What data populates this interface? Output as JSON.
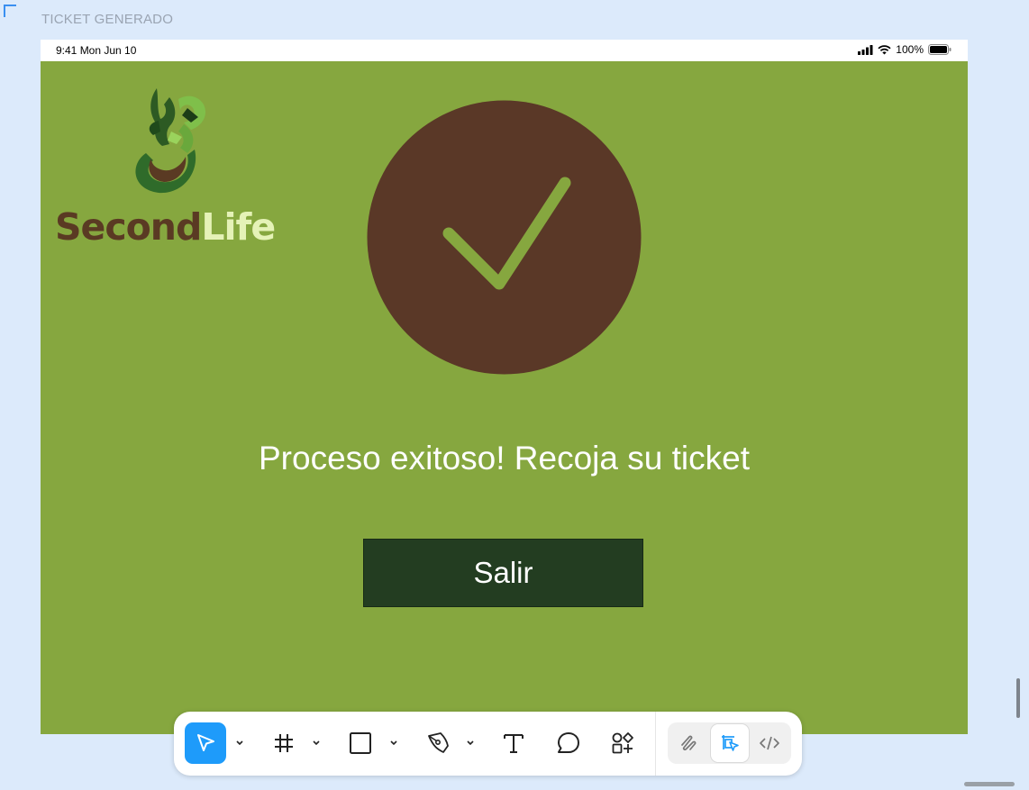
{
  "frame": {
    "label": "TICKET GENERADO"
  },
  "status_bar": {
    "time": "9:41  Mon Jun 10",
    "battery": "100%"
  },
  "logo": {
    "part1": "Second",
    "part2": "Life"
  },
  "main": {
    "message": "Proceso exitoso! Recoja su ticket",
    "exit_label": "Salir"
  },
  "colors": {
    "background": "#86a73f",
    "circle": "#5a3827",
    "button": "#233d21",
    "accent": "#1e9bfa"
  },
  "toolbar": {
    "tools": [
      {
        "icon": "move-pointer-icon",
        "active": true
      },
      {
        "icon": "frame-hash-icon"
      },
      {
        "icon": "rectangle-icon"
      },
      {
        "icon": "pen-icon"
      },
      {
        "icon": "text-tool-icon"
      },
      {
        "icon": "comment-icon"
      },
      {
        "icon": "components-icon"
      }
    ],
    "modes": [
      {
        "icon": "draw-mode-icon"
      },
      {
        "icon": "design-mode-icon",
        "active": true
      },
      {
        "icon": "dev-mode-icon"
      }
    ]
  }
}
